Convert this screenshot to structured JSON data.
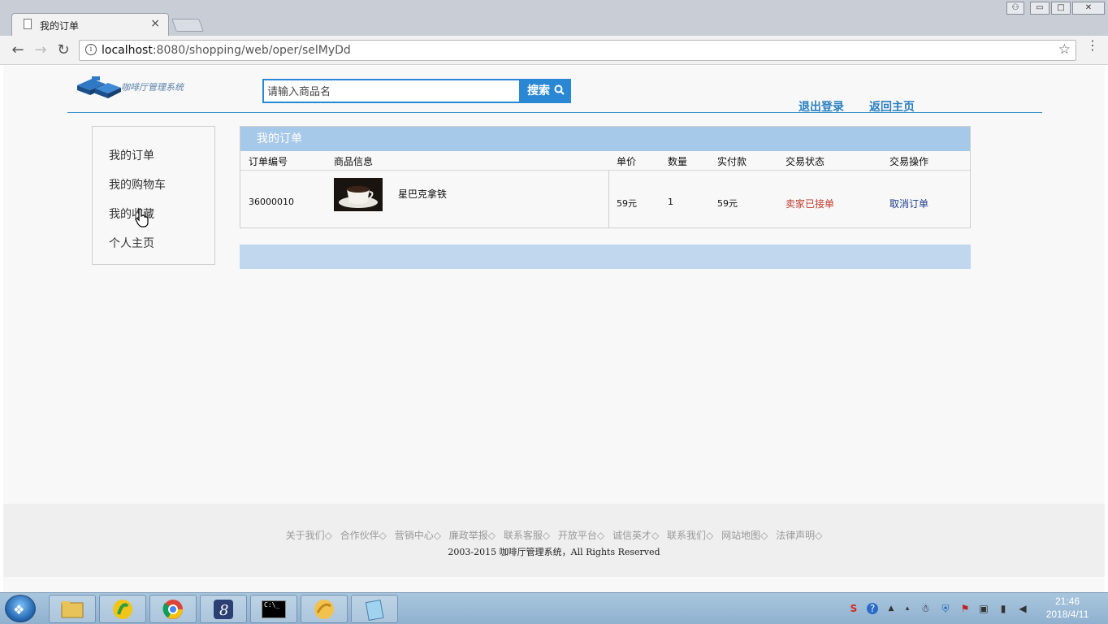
{
  "browser": {
    "tab_title": "我的订单",
    "tab_close": "×",
    "url_host": "localhost",
    "url_rest": ":8080/shopping/web/oper/selMyDd",
    "info_glyph": "i",
    "star_glyph": "☆",
    "back_glyph": "←",
    "forward_glyph": "→",
    "reload_glyph": "↻",
    "menu_glyph": "⋮",
    "window_controls": [
      "⚇",
      "▭",
      "□",
      "✕"
    ]
  },
  "header": {
    "logo_text": "咖啡厅管理系统",
    "search_placeholder": "请输入商品名",
    "search_button": "搜索",
    "search_icon": "search-icon",
    "logout_link": "退出登录",
    "home_link": "返回主页"
  },
  "sidebar": {
    "items": [
      {
        "label": "我的订单"
      },
      {
        "label": "我的购物车"
      },
      {
        "label": "我的收藏"
      },
      {
        "label": "个人主页"
      }
    ]
  },
  "orders": {
    "panel_title": "我的订单",
    "columns": [
      "订单编号",
      "商品信息",
      "单价",
      "数量",
      "实付款",
      "交易状态",
      "交易操作"
    ],
    "rows": [
      {
        "order_no": "36000010",
        "product_name": "星巴克拿铁",
        "unit_price": "59元",
        "quantity": "1",
        "paid": "59元",
        "status": "卖家已接单",
        "action": "取消订单"
      }
    ]
  },
  "footer": {
    "links": [
      "关于我们◇",
      "合作伙伴◇",
      "营销中心◇",
      "廉政举报◇",
      "联系客服◇",
      "开放平台◇",
      "诚信英才◇",
      "联系我们◇",
      "网站地图◇",
      "法律声明◇"
    ],
    "copyright": "2003-2015 咖啡厅管理系统，All Rights Reserved"
  },
  "taskbar": {
    "apps": [
      "file-explorer-icon",
      "qq-music-icon",
      "chrome-icon",
      "eclipse-icon",
      "cmd-icon",
      "app-icon",
      "notepad-icon"
    ],
    "cmd_label": "C:\\_",
    "time": "21:46",
    "date": "2018/4/11"
  },
  "colors": {
    "accent": "#2a87d4",
    "panel_header": "#a7c9e9",
    "status_red": "#c0392b",
    "action_blue": "#1c3a8a"
  }
}
